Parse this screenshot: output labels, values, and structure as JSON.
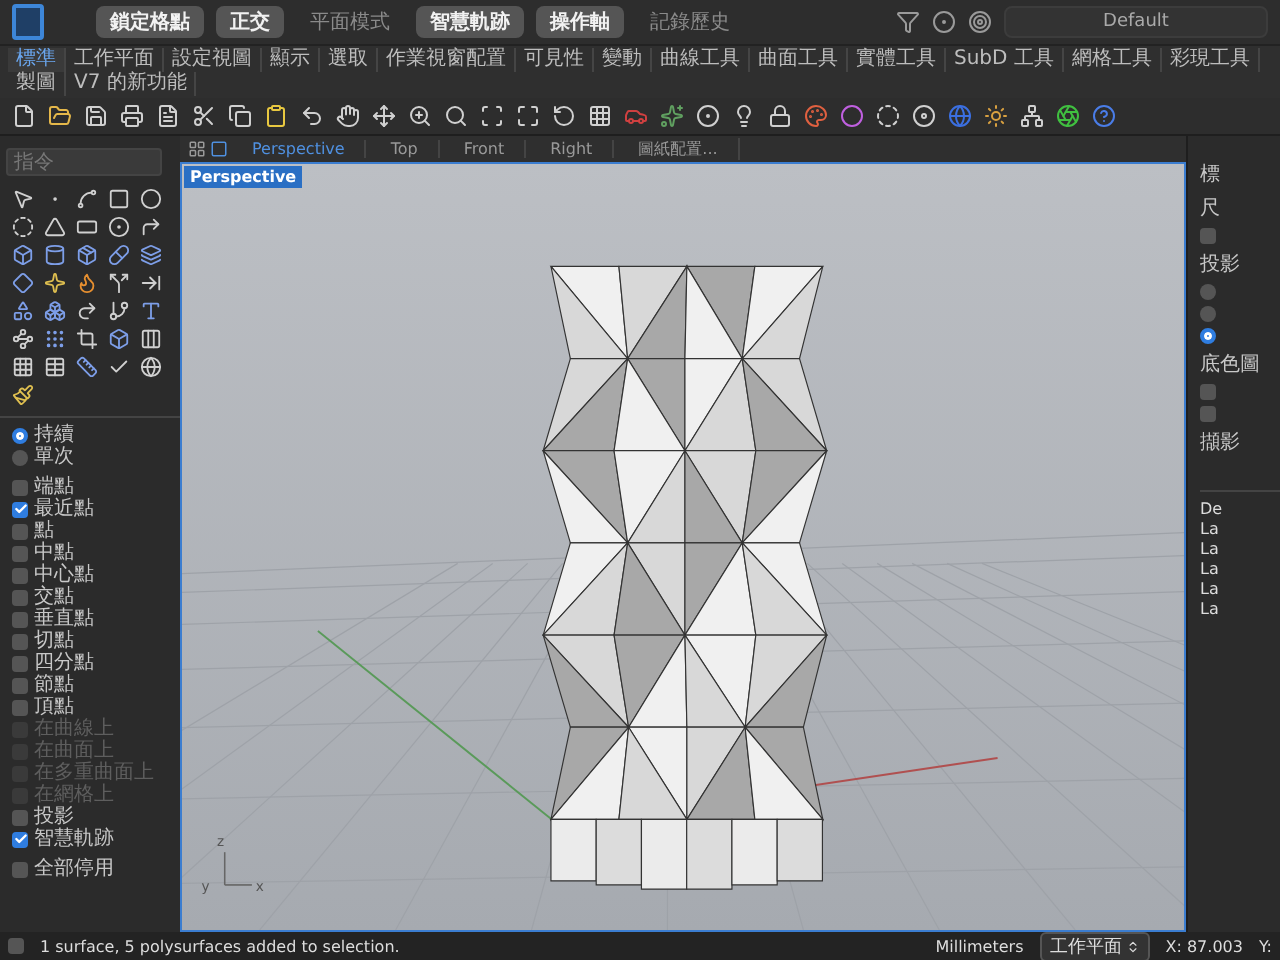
{
  "top_bar": {
    "toggles": [
      {
        "label": "鎖定格點",
        "on": true
      },
      {
        "label": "正交",
        "on": true
      },
      {
        "label": "平面模式",
        "on": false
      },
      {
        "label": "智慧軌跡",
        "on": true
      },
      {
        "label": "操作軸",
        "on": true
      },
      {
        "label": "記錄歷史",
        "on": false
      }
    ],
    "display_mode": {
      "value": "Default"
    }
  },
  "toolbar_tabs": [
    {
      "label": "標準",
      "selected": true
    },
    {
      "label": "工作平面",
      "selected": false
    },
    {
      "label": "設定視圖",
      "selected": false
    },
    {
      "label": "顯示",
      "selected": false
    },
    {
      "label": "選取",
      "selected": false
    },
    {
      "label": "作業視窗配置",
      "selected": false
    },
    {
      "label": "可見性",
      "selected": false
    },
    {
      "label": "變動",
      "selected": false
    },
    {
      "label": "曲線工具",
      "selected": false
    },
    {
      "label": "曲面工具",
      "selected": false
    },
    {
      "label": "實體工具",
      "selected": false
    },
    {
      "label": "SubD 工具",
      "selected": false
    },
    {
      "label": "網格工具",
      "selected": false
    },
    {
      "label": "彩現工具",
      "selected": false
    },
    {
      "label": "製圖",
      "selected": false
    },
    {
      "label": "V7 的新功能",
      "selected": false
    }
  ],
  "command": {
    "placeholder": "指令"
  },
  "osnap": {
    "modes": [
      {
        "label": "持續",
        "selected": true
      },
      {
        "label": "單次",
        "selected": false
      }
    ],
    "items": [
      {
        "label": "端點",
        "checked": false,
        "disabled": false
      },
      {
        "label": "最近點",
        "checked": true,
        "disabled": false
      },
      {
        "label": "點",
        "checked": false,
        "disabled": false
      },
      {
        "label": "中點",
        "checked": false,
        "disabled": false
      },
      {
        "label": "中心點",
        "checked": false,
        "disabled": false
      },
      {
        "label": "交點",
        "checked": false,
        "disabled": false
      },
      {
        "label": "垂直點",
        "checked": false,
        "disabled": false
      },
      {
        "label": "切點",
        "checked": false,
        "disabled": false
      },
      {
        "label": "四分點",
        "checked": false,
        "disabled": false
      },
      {
        "label": "節點",
        "checked": false,
        "disabled": false
      },
      {
        "label": "頂點",
        "checked": false,
        "disabled": false
      },
      {
        "label": "在曲線上",
        "checked": false,
        "disabled": true
      },
      {
        "label": "在曲面上",
        "checked": false,
        "disabled": true
      },
      {
        "label": "在多重曲面上",
        "checked": false,
        "disabled": true
      },
      {
        "label": "在網格上",
        "checked": false,
        "disabled": true
      },
      {
        "label": "投影",
        "checked": false,
        "disabled": false
      },
      {
        "label": "智慧軌跡",
        "checked": true,
        "disabled": false
      }
    ],
    "disable_all": {
      "label": "全部停用",
      "checked": false
    }
  },
  "viewport_tabs": [
    {
      "label": "Perspective",
      "selected": true
    },
    {
      "label": "Top",
      "selected": false
    },
    {
      "label": "Front",
      "selected": false
    },
    {
      "label": "Right",
      "selected": false
    },
    {
      "label": "圖紙配置...",
      "selected": false
    }
  ],
  "viewport": {
    "title": "Perspective",
    "axes": [
      "z",
      "y",
      "x"
    ]
  },
  "right_panel": {
    "label_1": "標",
    "label_2": "尺",
    "checkbox_1": {
      "checked": false
    },
    "projection": {
      "title": "投影",
      "options": [
        {
          "selected": false
        },
        {
          "selected": false
        },
        {
          "selected": true
        }
      ]
    },
    "background": {
      "title": "底色圖",
      "checkboxes": [
        {
          "checked": false
        },
        {
          "checked": false
        }
      ]
    },
    "capture_title": "擷影",
    "list": [
      "De",
      "La",
      "La",
      "La",
      "La",
      "La"
    ]
  },
  "status_bar": {
    "message": "1 surface, 5 polysurfaces added to selection.",
    "units": "Millimeters",
    "cplane": "工作平面",
    "x": "X: 87.003",
    "y": "Y:"
  }
}
